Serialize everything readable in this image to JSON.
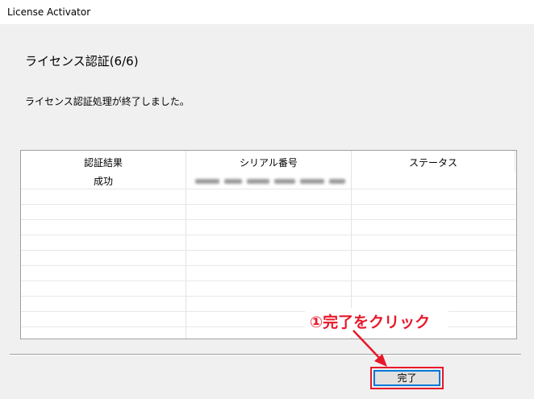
{
  "window": {
    "title": "License Activator"
  },
  "page": {
    "step_title": "ライセンス認証(6/6)",
    "message": "ライセンス認証処理が終了しました。"
  },
  "table": {
    "columns": [
      "認証結果",
      "シリアル番号",
      "ステータス"
    ],
    "rows": [
      {
        "result": "成功",
        "serial": "",
        "status": ""
      }
    ]
  },
  "annotation": {
    "text": "①完了をクリック",
    "color": "#e8182b"
  },
  "buttons": {
    "finish_label": "完了"
  },
  "colors": {
    "highlight": "#e8182b",
    "focus": "#0078d7"
  }
}
